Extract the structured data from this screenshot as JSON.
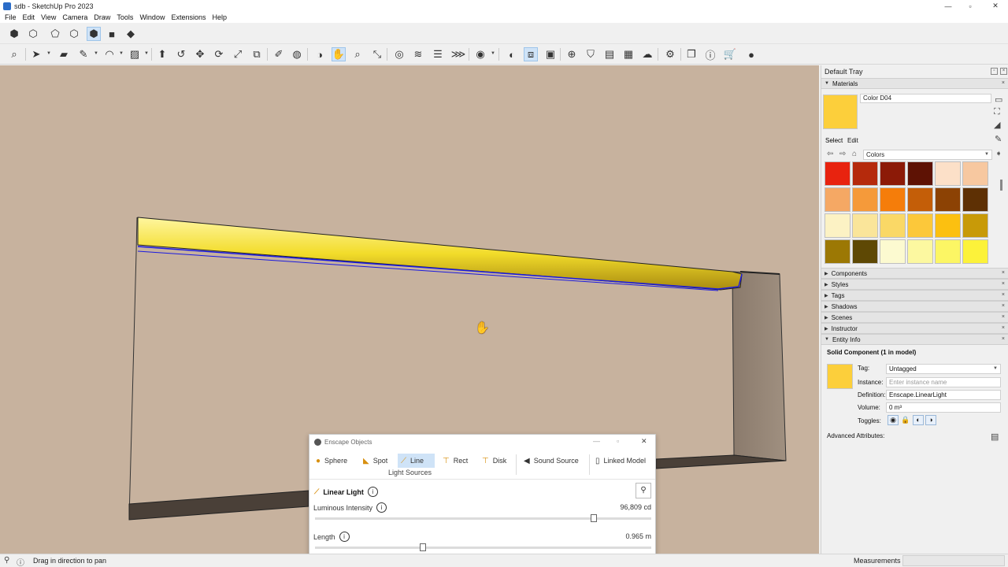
{
  "window": {
    "title": "sdb - SketchUp Pro 2023",
    "minimize": "—",
    "maximize": "▫",
    "close": "✕"
  },
  "menu": [
    "File",
    "Edit",
    "View",
    "Camera",
    "Draw",
    "Tools",
    "Window",
    "Extensions",
    "Help"
  ],
  "tray": {
    "title": "Default Tray",
    "materials": {
      "panel_label": "Materials",
      "current_name": "Color D04",
      "current_color": "#fccf3b",
      "tabs": [
        "Select",
        "Edit"
      ],
      "library": "Colors",
      "swatches": [
        "#e8230f",
        "#b52a0c",
        "#8c1a07",
        "#5e1204",
        "#fce0c8",
        "#f7c8a0",
        "#f5a864",
        "#f59a3a",
        "#f57d0a",
        "#c45e08",
        "#8c4204",
        "#5e3004",
        "#fcf2c4",
        "#fae59a",
        "#fad866",
        "#fcc83a",
        "#fcc010",
        "#c89a08",
        "#9c7804",
        "#5e4804",
        "#fcfad0",
        "#fcf8a0",
        "#fcf664",
        "#fcf23a"
      ]
    },
    "collapsed_panels": [
      "Components",
      "Styles",
      "Tags",
      "Shadows",
      "Scenes",
      "Instructor"
    ],
    "entity_info": {
      "panel_label": "Entity Info",
      "heading": "Solid Component (1 in model)",
      "swatch_color": "#fccf3b",
      "tag_label": "Tag:",
      "tag_value": "Untagged",
      "instance_label": "Instance:",
      "instance_placeholder": "Enter instance name",
      "definition_label": "Definition:",
      "definition_value": "Enscape.LinearLight",
      "volume_label": "Volume:",
      "volume_value": "0 m³",
      "toggles_label": "Toggles:",
      "advanced_label": "Advanced Attributes:"
    }
  },
  "enscape": {
    "title": "Enscape Objects",
    "tabs": [
      {
        "label": "Sphere",
        "icon": "sphere-icon"
      },
      {
        "label": "Spot",
        "icon": "spot-icon"
      },
      {
        "label": "Line",
        "icon": "line-icon"
      },
      {
        "label": "Rect",
        "icon": "rect-icon"
      },
      {
        "label": "Disk",
        "icon": "disk-icon"
      },
      {
        "label": "Sound Source",
        "icon": "speaker-icon"
      },
      {
        "label": "Linked Model",
        "icon": "linked-model-icon"
      }
    ],
    "selected_tab": "Line",
    "group_label": "Light Sources",
    "object_title": "Linear Light",
    "luminous_label": "Luminous Intensity",
    "luminous_value": "96,809 cd",
    "luminous_fraction": 0.83,
    "length_label": "Length",
    "length_value": "0.965 m",
    "length_fraction": 0.32
  },
  "status": {
    "hint": "Drag in direction to pan",
    "measurements_label": "Measurements"
  },
  "colors": {
    "sky": "#c7b29e",
    "light_yellow": "#fbe04a",
    "selection_blue": "#1a1ae0",
    "active_tab": "#cfe3f7"
  }
}
